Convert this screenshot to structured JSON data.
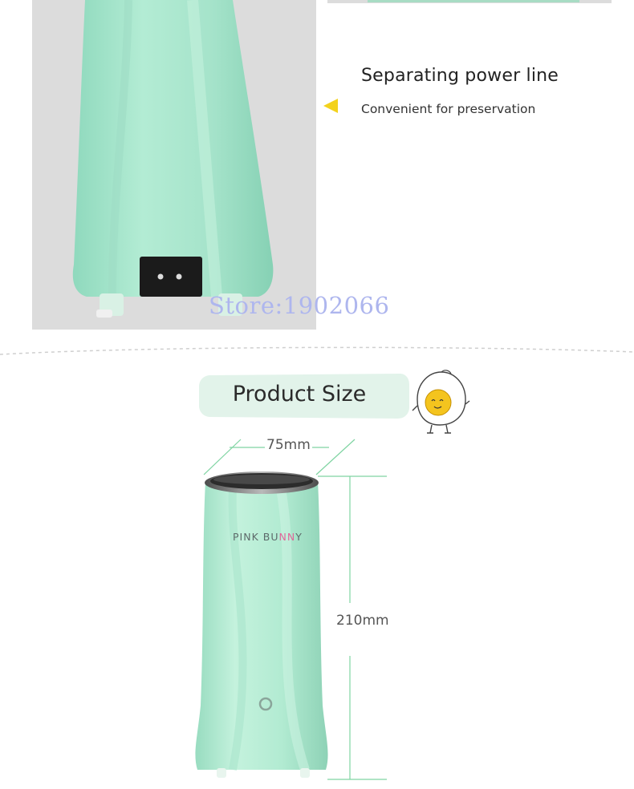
{
  "feature": {
    "title": "Separating power line",
    "subtitle": "Convenient for preservation"
  },
  "watermark": "Store:1902066",
  "size_section": {
    "title": "Product Size",
    "width_label": "75mm",
    "height_label": "210mm"
  },
  "product": {
    "brand_main": "PINK BU",
    "brand_accent": "NN",
    "brand_end": "Y"
  },
  "colors": {
    "mint_body": "#a8e4ca",
    "banner": "#e2f3ea",
    "arrow": "#f3d21c",
    "dimension_line": "#7fd4a2",
    "watermark": "#aeb6ee"
  },
  "icons": {
    "arrow": "triangle-left-icon",
    "mascot": "egg-mascot-icon",
    "socket": "power-socket-icon",
    "button": "power-button-icon"
  }
}
